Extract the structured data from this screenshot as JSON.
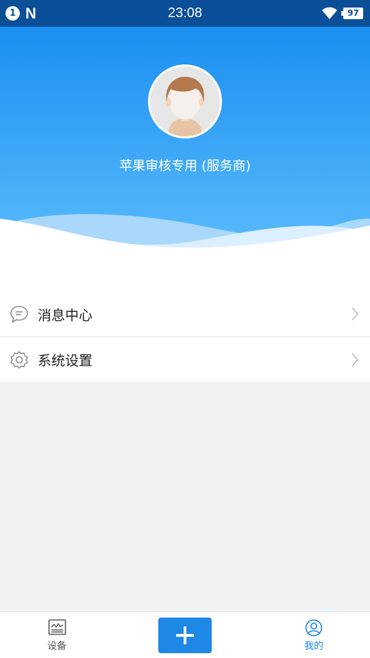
{
  "status_bar": {
    "notification_count": "1",
    "notification_letter": "N",
    "time": "23:08",
    "battery": "97",
    "icons": [
      "notification-badge",
      "n-logo-icon",
      "wifi-icon",
      "battery-icon"
    ]
  },
  "profile": {
    "username": "苹果审核专用 (服务商)",
    "avatar_icon": "avatar-icon"
  },
  "menu": {
    "items": [
      {
        "label": "消息中心",
        "icon": "message-icon"
      },
      {
        "label": "系统设置",
        "icon": "gear-icon"
      }
    ]
  },
  "bottom_nav": {
    "tabs": [
      {
        "label": "设备",
        "icon": "device-monitor-icon",
        "active": false
      },
      {
        "label": "我的",
        "icon": "user-icon",
        "active": true
      }
    ],
    "add_icon": "plus-icon"
  },
  "colors": {
    "status_bar": "#0a4f97",
    "header_top": "#1a8ff0",
    "header_bottom": "#5cbcfb",
    "accent": "#1e88e5",
    "page_background": "#f1f2f4"
  }
}
